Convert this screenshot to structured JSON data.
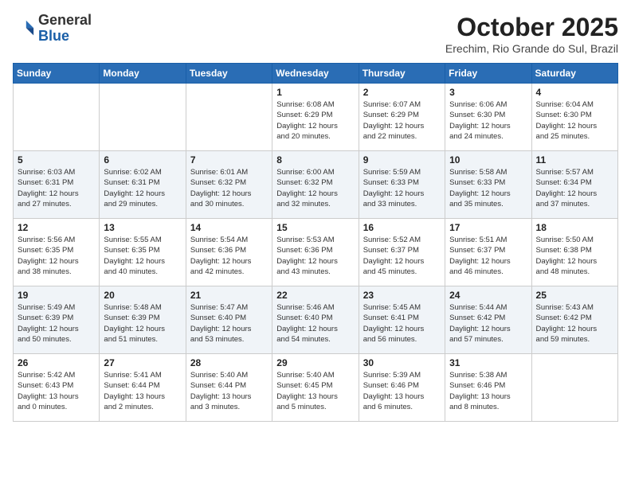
{
  "logo": {
    "general": "General",
    "blue": "Blue"
  },
  "header": {
    "month": "October 2025",
    "location": "Erechim, Rio Grande do Sul, Brazil"
  },
  "weekdays": [
    "Sunday",
    "Monday",
    "Tuesday",
    "Wednesday",
    "Thursday",
    "Friday",
    "Saturday"
  ],
  "weeks": [
    [
      {
        "day": "",
        "info": ""
      },
      {
        "day": "",
        "info": ""
      },
      {
        "day": "",
        "info": ""
      },
      {
        "day": "1",
        "info": "Sunrise: 6:08 AM\nSunset: 6:29 PM\nDaylight: 12 hours\nand 20 minutes."
      },
      {
        "day": "2",
        "info": "Sunrise: 6:07 AM\nSunset: 6:29 PM\nDaylight: 12 hours\nand 22 minutes."
      },
      {
        "day": "3",
        "info": "Sunrise: 6:06 AM\nSunset: 6:30 PM\nDaylight: 12 hours\nand 24 minutes."
      },
      {
        "day": "4",
        "info": "Sunrise: 6:04 AM\nSunset: 6:30 PM\nDaylight: 12 hours\nand 25 minutes."
      }
    ],
    [
      {
        "day": "5",
        "info": "Sunrise: 6:03 AM\nSunset: 6:31 PM\nDaylight: 12 hours\nand 27 minutes."
      },
      {
        "day": "6",
        "info": "Sunrise: 6:02 AM\nSunset: 6:31 PM\nDaylight: 12 hours\nand 29 minutes."
      },
      {
        "day": "7",
        "info": "Sunrise: 6:01 AM\nSunset: 6:32 PM\nDaylight: 12 hours\nand 30 minutes."
      },
      {
        "day": "8",
        "info": "Sunrise: 6:00 AM\nSunset: 6:32 PM\nDaylight: 12 hours\nand 32 minutes."
      },
      {
        "day": "9",
        "info": "Sunrise: 5:59 AM\nSunset: 6:33 PM\nDaylight: 12 hours\nand 33 minutes."
      },
      {
        "day": "10",
        "info": "Sunrise: 5:58 AM\nSunset: 6:33 PM\nDaylight: 12 hours\nand 35 minutes."
      },
      {
        "day": "11",
        "info": "Sunrise: 5:57 AM\nSunset: 6:34 PM\nDaylight: 12 hours\nand 37 minutes."
      }
    ],
    [
      {
        "day": "12",
        "info": "Sunrise: 5:56 AM\nSunset: 6:35 PM\nDaylight: 12 hours\nand 38 minutes."
      },
      {
        "day": "13",
        "info": "Sunrise: 5:55 AM\nSunset: 6:35 PM\nDaylight: 12 hours\nand 40 minutes."
      },
      {
        "day": "14",
        "info": "Sunrise: 5:54 AM\nSunset: 6:36 PM\nDaylight: 12 hours\nand 42 minutes."
      },
      {
        "day": "15",
        "info": "Sunrise: 5:53 AM\nSunset: 6:36 PM\nDaylight: 12 hours\nand 43 minutes."
      },
      {
        "day": "16",
        "info": "Sunrise: 5:52 AM\nSunset: 6:37 PM\nDaylight: 12 hours\nand 45 minutes."
      },
      {
        "day": "17",
        "info": "Sunrise: 5:51 AM\nSunset: 6:37 PM\nDaylight: 12 hours\nand 46 minutes."
      },
      {
        "day": "18",
        "info": "Sunrise: 5:50 AM\nSunset: 6:38 PM\nDaylight: 12 hours\nand 48 minutes."
      }
    ],
    [
      {
        "day": "19",
        "info": "Sunrise: 5:49 AM\nSunset: 6:39 PM\nDaylight: 12 hours\nand 50 minutes."
      },
      {
        "day": "20",
        "info": "Sunrise: 5:48 AM\nSunset: 6:39 PM\nDaylight: 12 hours\nand 51 minutes."
      },
      {
        "day": "21",
        "info": "Sunrise: 5:47 AM\nSunset: 6:40 PM\nDaylight: 12 hours\nand 53 minutes."
      },
      {
        "day": "22",
        "info": "Sunrise: 5:46 AM\nSunset: 6:40 PM\nDaylight: 12 hours\nand 54 minutes."
      },
      {
        "day": "23",
        "info": "Sunrise: 5:45 AM\nSunset: 6:41 PM\nDaylight: 12 hours\nand 56 minutes."
      },
      {
        "day": "24",
        "info": "Sunrise: 5:44 AM\nSunset: 6:42 PM\nDaylight: 12 hours\nand 57 minutes."
      },
      {
        "day": "25",
        "info": "Sunrise: 5:43 AM\nSunset: 6:42 PM\nDaylight: 12 hours\nand 59 minutes."
      }
    ],
    [
      {
        "day": "26",
        "info": "Sunrise: 5:42 AM\nSunset: 6:43 PM\nDaylight: 13 hours\nand 0 minutes."
      },
      {
        "day": "27",
        "info": "Sunrise: 5:41 AM\nSunset: 6:44 PM\nDaylight: 13 hours\nand 2 minutes."
      },
      {
        "day": "28",
        "info": "Sunrise: 5:40 AM\nSunset: 6:44 PM\nDaylight: 13 hours\nand 3 minutes."
      },
      {
        "day": "29",
        "info": "Sunrise: 5:40 AM\nSunset: 6:45 PM\nDaylight: 13 hours\nand 5 minutes."
      },
      {
        "day": "30",
        "info": "Sunrise: 5:39 AM\nSunset: 6:46 PM\nDaylight: 13 hours\nand 6 minutes."
      },
      {
        "day": "31",
        "info": "Sunrise: 5:38 AM\nSunset: 6:46 PM\nDaylight: 13 hours\nand 8 minutes."
      },
      {
        "day": "",
        "info": ""
      }
    ]
  ]
}
